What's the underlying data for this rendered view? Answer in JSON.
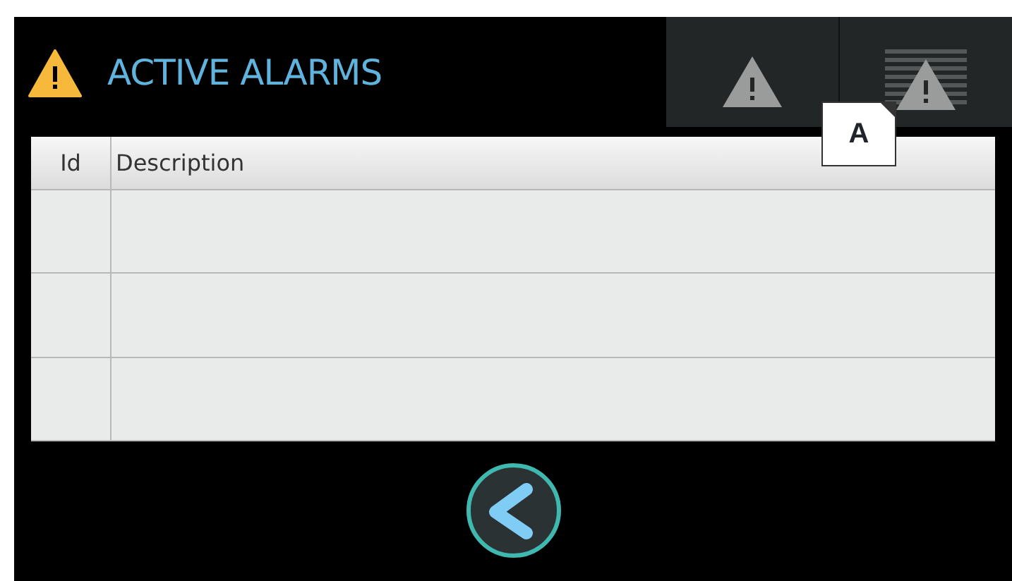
{
  "header": {
    "title": "ACTIVE ALARMS"
  },
  "toolbar": [
    {
      "kind": "alarm"
    },
    {
      "kind": "alarm-list"
    }
  ],
  "table": {
    "columns": [
      "Id",
      "Description"
    ],
    "rows": [
      {
        "kind": "empty"
      },
      {
        "kind": "empty"
      },
      {
        "kind": "empty"
      }
    ]
  },
  "callout": {
    "label": "A"
  }
}
